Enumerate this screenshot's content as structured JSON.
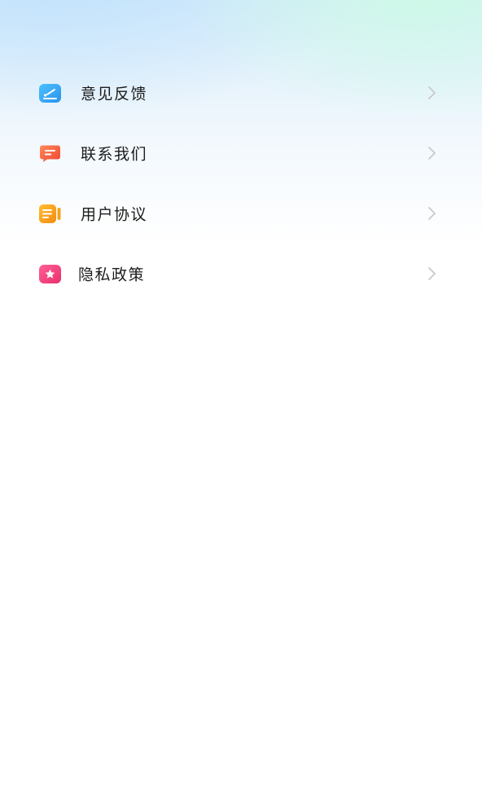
{
  "menu": {
    "items": [
      {
        "label": "意见反馈",
        "icon": "feedback-edit-icon",
        "color": "#3aa8f5"
      },
      {
        "label": "联系我们",
        "icon": "chat-bubble-icon",
        "color": "#f0553a"
      },
      {
        "label": "用户协议",
        "icon": "document-icon",
        "color": "#f59a1a"
      },
      {
        "label": "隐私政策",
        "icon": "star-shield-icon",
        "color": "#f0427e"
      }
    ]
  },
  "chevron_icon": "chevron-right-icon"
}
